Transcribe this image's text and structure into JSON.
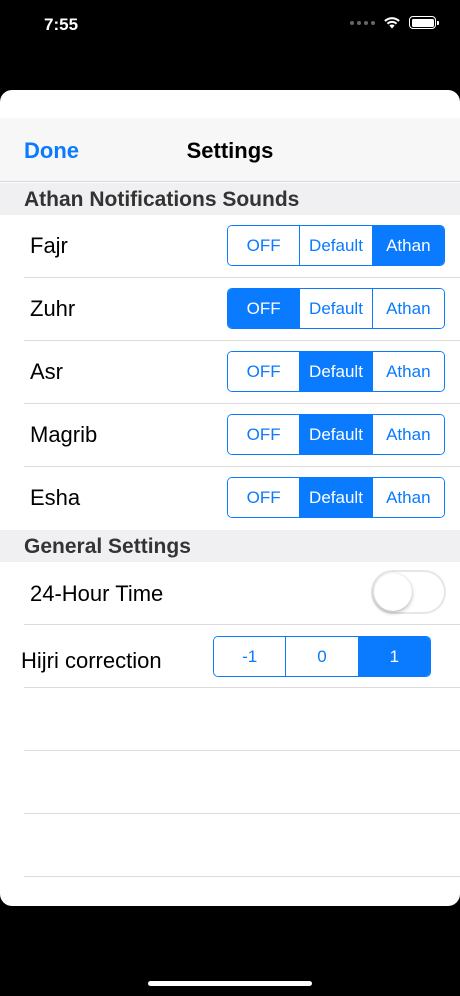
{
  "status_bar": {
    "time": "7:55"
  },
  "navbar": {
    "done_label": "Done",
    "title": "Settings"
  },
  "sections": {
    "athan": {
      "title": "Athan Notifications Sounds"
    },
    "general": {
      "title": "General Settings"
    }
  },
  "athan_rows": [
    {
      "label": "Fajr",
      "options": [
        "OFF",
        "Default",
        "Athan"
      ],
      "selected": 2
    },
    {
      "label": "Zuhr",
      "options": [
        "OFF",
        "Default",
        "Athan"
      ],
      "selected": 0
    },
    {
      "label": "Asr",
      "options": [
        "OFF",
        "Default",
        "Athan"
      ],
      "selected": 1
    },
    {
      "label": "Magrib",
      "options": [
        "OFF",
        "Default",
        "Athan"
      ],
      "selected": 1
    },
    {
      "label": "Esha",
      "options": [
        "OFF",
        "Default",
        "Athan"
      ],
      "selected": 1
    }
  ],
  "time_format": {
    "label": "24-Hour Time",
    "enabled": false
  },
  "hijri": {
    "label": "Hijri correction",
    "options": [
      "-1",
      "0",
      "1"
    ],
    "selected": 2
  },
  "colors": {
    "accent": "#0a7aff",
    "header_bg": "#f0f0f2",
    "nav_bg": "#f7f7f7"
  },
  "icons": {
    "wifi": "wifi-icon",
    "battery": "battery-icon",
    "signal": "signal-icon"
  }
}
